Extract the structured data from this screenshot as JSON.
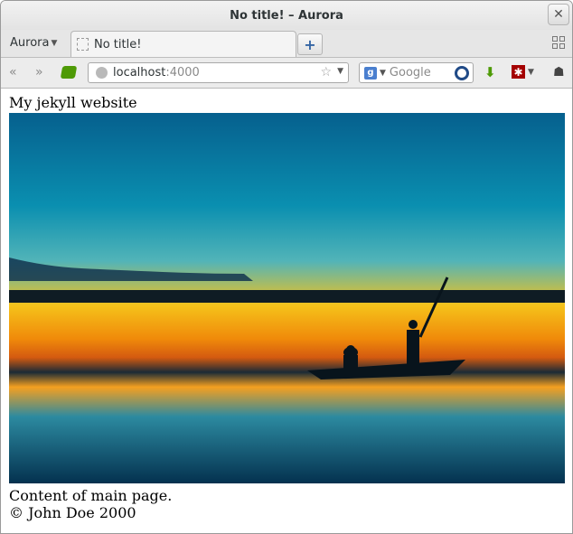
{
  "window": {
    "title": "No title! – Aurora"
  },
  "tabstrip": {
    "app_menu": "Aurora",
    "tab_title": "No title!",
    "new_tab": "+"
  },
  "navbar": {
    "url_host": "localhost",
    "url_port": ":4000",
    "search_placeholder": "Google",
    "search_engine_letter": "g"
  },
  "page": {
    "site_title": "My jekyll website",
    "main_content": "Content of main page.",
    "footer": "© John Doe 2000"
  }
}
